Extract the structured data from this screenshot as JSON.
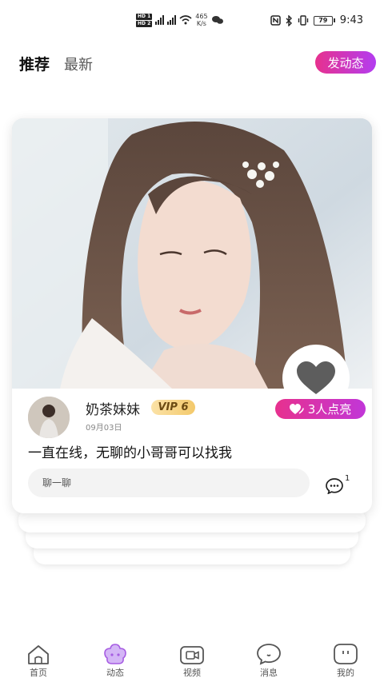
{
  "status_bar": {
    "network_speed_value": "465",
    "network_speed_unit": "K/s",
    "battery": "79",
    "time": "9:43"
  },
  "header": {
    "tabs": [
      {
        "label": "推荐",
        "active": true
      },
      {
        "label": "最新",
        "active": false
      }
    ],
    "post_button": "发动态"
  },
  "post": {
    "username": "奶茶妹妹",
    "vip_label": "VIP 6",
    "date": "09月03日",
    "likes_label": "3人点亮",
    "content": "一直在线，无聊的小哥哥可以找我",
    "chat_placeholder": "聊一聊",
    "comment_count": "1"
  },
  "bottom_nav": [
    {
      "label": "首页",
      "icon": "home-icon",
      "active": false
    },
    {
      "label": "动态",
      "icon": "moments-icon",
      "active": true
    },
    {
      "label": "视频",
      "icon": "video-icon",
      "active": false
    },
    {
      "label": "消息",
      "icon": "message-icon",
      "active": false
    },
    {
      "label": "我的",
      "icon": "profile-icon",
      "active": false
    }
  ],
  "colors": {
    "accent_gradient_start": "#e7318e",
    "accent_gradient_end": "#b33df0",
    "active_nav": "#b14ee0"
  }
}
